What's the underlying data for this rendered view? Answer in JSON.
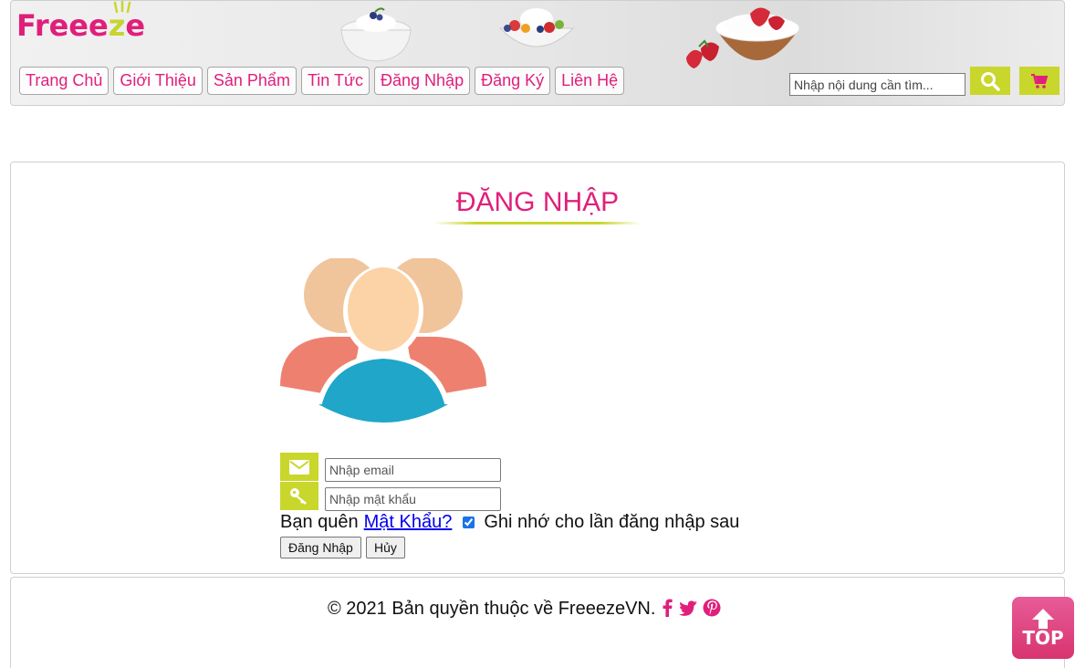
{
  "header": {
    "logo": {
      "part1": "Freee",
      "part2": "z",
      "part3": "e"
    },
    "nav": [
      {
        "label": "Trang Chủ"
      },
      {
        "label": "Giới Thiệu"
      },
      {
        "label": "Sản Phẩm"
      },
      {
        "label": "Tin Tức"
      },
      {
        "label": "Đăng Nhập"
      },
      {
        "label": "Đăng Ký"
      },
      {
        "label": "Liên Hệ"
      }
    ],
    "search": {
      "placeholder": "Nhập nội dung cần tìm...",
      "value": ""
    },
    "search_button_icon": "search-icon",
    "cart_button_icon": "cart-icon"
  },
  "login": {
    "title": "ĐĂNG NHẬP",
    "avatar_icon": "users-group-icon",
    "email": {
      "placeholder": "Nhập email",
      "icon": "envelope-icon"
    },
    "password": {
      "placeholder": "Nhập mật khẩu",
      "icon": "key-icon"
    },
    "forgot_prefix": "Bạn quên",
    "forgot_link": "Mật Khẩu?",
    "remember_label": "Ghi nhớ cho lần đăng nhập sau",
    "remember_checked": true,
    "submit_label": "Đăng Nhập",
    "cancel_label": "Hủy"
  },
  "footer": {
    "copyright": "© 2021 Bản quyền thuộc về FreeezeVN.",
    "social": [
      "facebook-icon",
      "twitter-icon",
      "pinterest-icon"
    ]
  },
  "back_to_top": {
    "label": "TOP"
  },
  "colors": {
    "brand_pink": "#e01f7b",
    "accent_lime": "#c9d62c"
  }
}
